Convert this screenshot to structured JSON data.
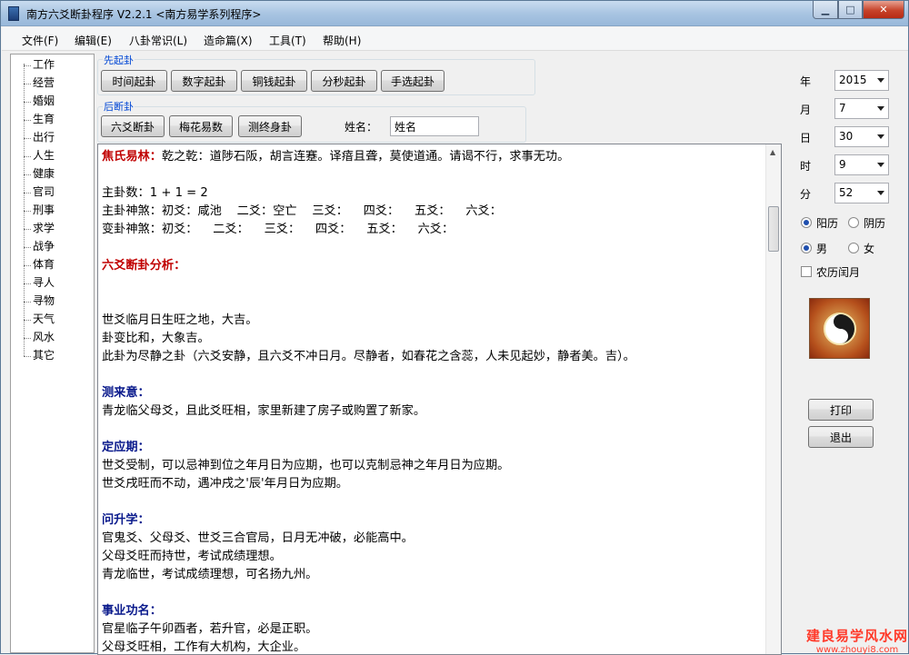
{
  "window": {
    "title": "南方六爻断卦程序 V2.2.1   <南方易学系列程序>"
  },
  "menu": [
    "文件(F)",
    "编辑(E)",
    "八卦常识(L)",
    "造命篇(X)",
    "工具(T)",
    "帮助(H)"
  ],
  "tree": [
    "工作",
    "经营",
    "婚姻",
    "生育",
    "出行",
    "人生",
    "健康",
    "官司",
    "刑事",
    "求学",
    "战争",
    "体育",
    "寻人",
    "寻物",
    "天气",
    "风水",
    "其它"
  ],
  "group1": {
    "label": "先起卦",
    "buttons": [
      "时间起卦",
      "数字起卦",
      "铜钱起卦",
      "分秒起卦",
      "手选起卦"
    ]
  },
  "group2": {
    "label": "后断卦",
    "buttons": [
      "六爻断卦",
      "梅花易数",
      "测终身卦"
    ]
  },
  "name": {
    "label": "姓名：",
    "value": "姓名"
  },
  "text": [
    {
      "style": "red-head",
      "head": "焦氏易林：",
      "text": "乾之乾：道陟石阪，胡言连蹇。译瘖且聋，莫使道通。请谒不行，求事无功。"
    },
    {
      "style": "plain",
      "text": ""
    },
    {
      "style": "plain",
      "text": "主卦数：1 + 1 = 2"
    },
    {
      "style": "plain",
      "text": "主卦神煞：初爻：咸池    二爻：空亡    三爻：    四爻：    五爻：    六爻："
    },
    {
      "style": "plain",
      "text": "变卦神煞：初爻：    二爻：    三爻：    四爻：    五爻：    六爻："
    },
    {
      "style": "plain",
      "text": ""
    },
    {
      "style": "red",
      "text": "六爻断卦分析："
    },
    {
      "style": "plain",
      "text": ""
    },
    {
      "style": "plain",
      "text": ""
    },
    {
      "style": "plain",
      "text": "世爻临月日生旺之地，大吉。"
    },
    {
      "style": "plain",
      "text": "卦变比和，大象吉。"
    },
    {
      "style": "plain",
      "text": "此卦为尽静之卦（六爻安静，且六爻不冲日月。尽静者，如春花之含蕊，人未见起妙，静者美。吉）。"
    },
    {
      "style": "plain",
      "text": ""
    },
    {
      "style": "blue",
      "text": "测来意："
    },
    {
      "style": "plain",
      "text": "青龙临父母爻，且此爻旺相，家里新建了房子或购置了新家。"
    },
    {
      "style": "plain",
      "text": ""
    },
    {
      "style": "blue",
      "text": "定应期："
    },
    {
      "style": "plain",
      "text": "世爻受制，可以忌神到位之年月日为应期，也可以克制忌神之年月日为应期。"
    },
    {
      "style": "plain",
      "text": "世爻戌旺而不动，遇冲戌之'辰'年月日为应期。"
    },
    {
      "style": "plain",
      "text": ""
    },
    {
      "style": "blue",
      "text": "问升学："
    },
    {
      "style": "plain",
      "text": "官鬼爻、父母爻、世爻三合官局，日月无冲破，必能高中。"
    },
    {
      "style": "plain",
      "text": "父母爻旺而持世，考试成绩理想。"
    },
    {
      "style": "plain",
      "text": "青龙临世，考试成绩理想，可名扬九州。"
    },
    {
      "style": "plain",
      "text": ""
    },
    {
      "style": "blue",
      "text": "事业功名："
    },
    {
      "style": "plain",
      "text": "官星临子午卯酉者，若升官，必是正职。"
    },
    {
      "style": "plain",
      "text": "父母爻旺相，工作有大机构，大企业。"
    }
  ],
  "date": {
    "year": {
      "label": "年",
      "value": "2015"
    },
    "month": {
      "label": "月",
      "value": "7"
    },
    "day": {
      "label": "日",
      "value": "30"
    },
    "hour": {
      "label": "时",
      "value": "9"
    },
    "minute": {
      "label": "分",
      "value": "52"
    }
  },
  "calendar": {
    "solar": "阳历",
    "lunar": "阴历",
    "selected": "solar"
  },
  "gender": {
    "male": "男",
    "female": "女",
    "selected": "male"
  },
  "leap": {
    "label": "农历闰月",
    "checked": false
  },
  "actions": {
    "print": "打印",
    "exit": "退出"
  },
  "watermark": {
    "line1": "建良易学风水网",
    "line2": "www.zhouyi8.com"
  }
}
